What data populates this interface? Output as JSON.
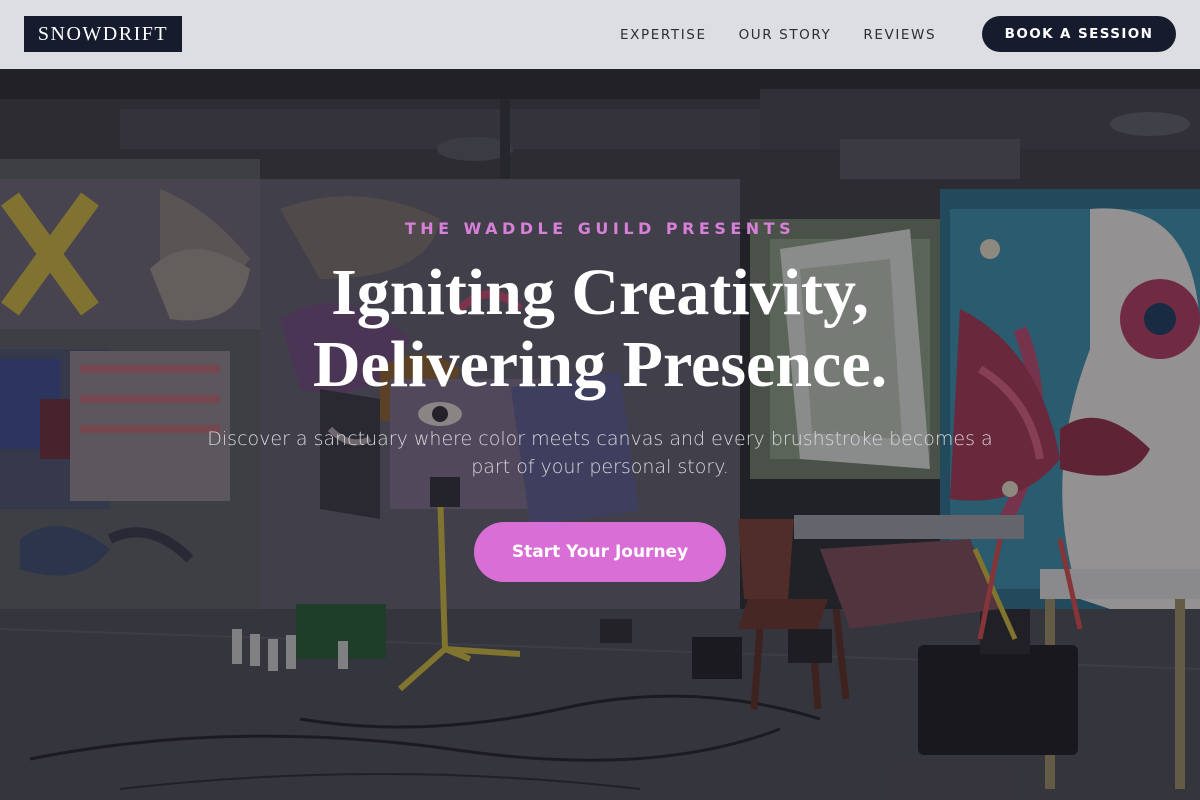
{
  "brand": {
    "logo": "SNOWDRIFT"
  },
  "nav": {
    "items": [
      {
        "label": "EXPERTISE"
      },
      {
        "label": "OUR STORY"
      },
      {
        "label": "REVIEWS"
      }
    ],
    "cta_label": "BOOK A SESSION"
  },
  "hero": {
    "eyebrow": "THE WADDLE GUILD PRESENTS",
    "headline_line1": "Igniting Creativity,",
    "headline_line2": "Delivering Presence.",
    "subcopy": "Discover a sanctuary where color meets canvas and every brushstroke becomes a part of your personal story.",
    "cta_label": "Start Your Journey",
    "background_image": "graffiti-art-studio-photo"
  },
  "colors": {
    "navy": "#161b2e",
    "header_bg": "#dddee1",
    "accent_pink": "#d96ed6",
    "eyebrow_pink": "#d77fd9"
  }
}
